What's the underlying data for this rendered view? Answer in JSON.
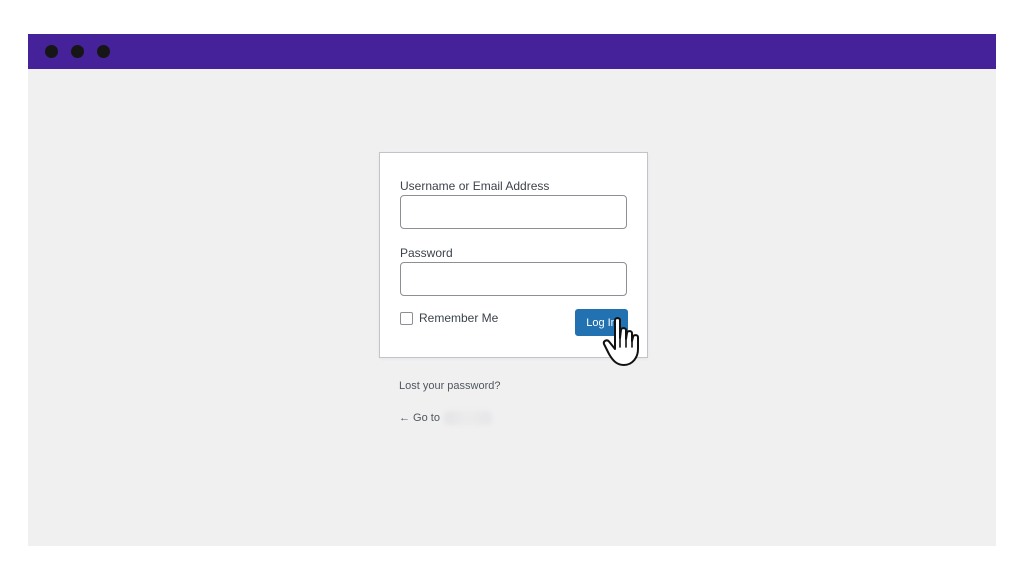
{
  "colors": {
    "title_bar": "#46229a",
    "page_background": "#f0f0f1",
    "primary_button": "#2271b1"
  },
  "login_form": {
    "username_label": "Username or Email Address",
    "username_value": "",
    "password_label": "Password",
    "password_value": "",
    "remember_label": "Remember Me",
    "remember_checked": false,
    "submit_label": "Log In"
  },
  "links": {
    "lost_password": "Lost your password?",
    "back_prefix": "← Go to"
  },
  "icons": {
    "cursor": "hand-pointer-icon"
  }
}
